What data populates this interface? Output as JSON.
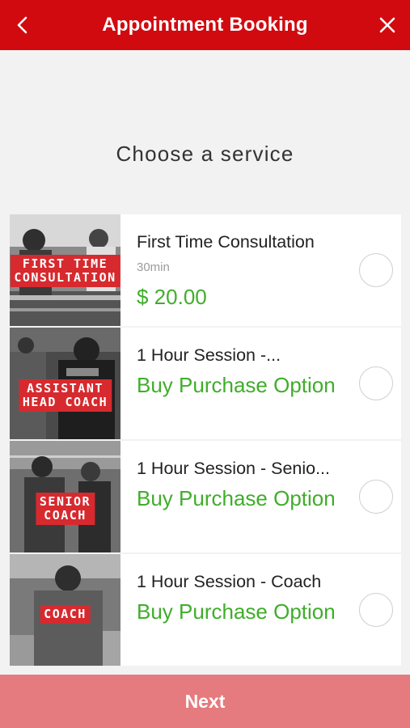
{
  "header": {
    "title": "Appointment Booking",
    "back_icon": "chevron-left-icon",
    "close_icon": "close-icon",
    "bg_color": "#d10a10"
  },
  "prompt": "Choose a service",
  "services": [
    {
      "image_tag": "FIRST TIME\nCONSULTATION",
      "name": "First Time Consultation",
      "duration": "30min",
      "price": "$ 20.00"
    },
    {
      "image_tag": "ASSISTANT\nHEAD COACH",
      "name": "1 Hour Session -...",
      "buy_label": "Buy Purchase Option"
    },
    {
      "image_tag": "SENIOR\nCOACH",
      "name": "1 Hour Session - Senio...",
      "buy_label": "Buy Purchase Option"
    },
    {
      "image_tag": "COACH",
      "name": "1 Hour Session - Coach",
      "buy_label": "Buy Purchase Option"
    }
  ],
  "footer": {
    "next_label": "Next",
    "next_color": "#e57b7e"
  },
  "colors": {
    "accent_green": "#3fae2a",
    "tag_red": "#d62a2f"
  }
}
